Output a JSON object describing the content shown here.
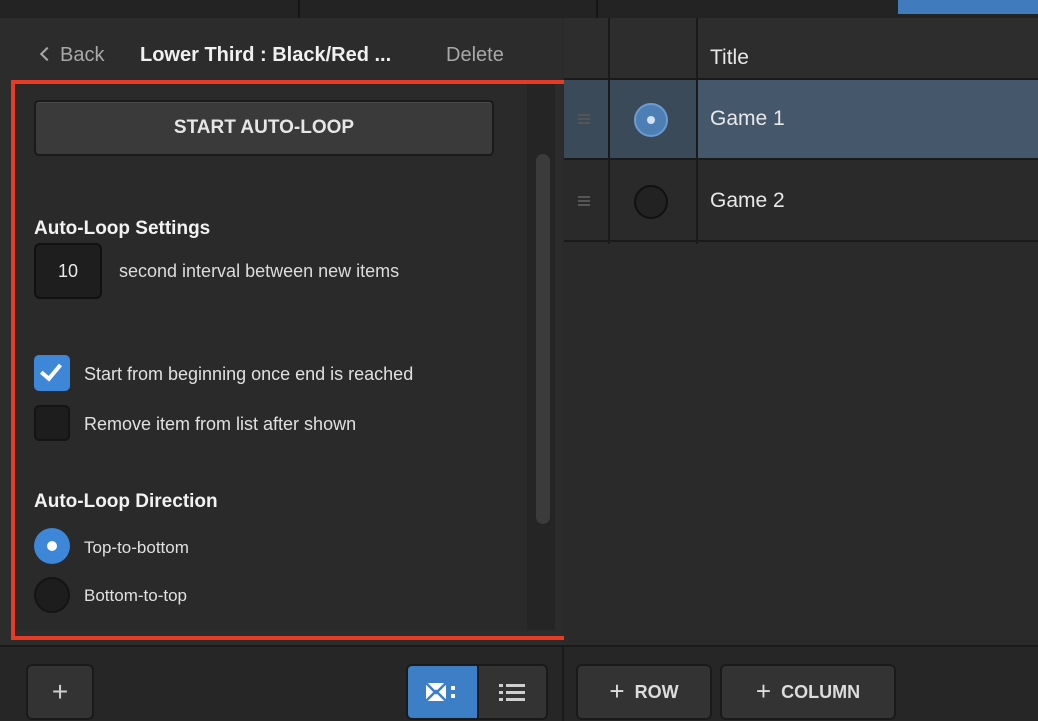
{
  "header": {
    "back_label": "Back",
    "title": "Lower Third : Black/Red ...",
    "delete_label": "Delete"
  },
  "autoloop": {
    "start_button": "START AUTO-LOOP",
    "settings_title": "Auto-Loop Settings",
    "interval_value": "10",
    "interval_label": "second interval between new items",
    "options": [
      {
        "label": "Start from beginning once end is reached",
        "checked": true
      },
      {
        "label": "Remove item from list after shown",
        "checked": false
      }
    ],
    "direction_title": "Auto-Loop Direction",
    "directions": [
      {
        "label": "Top-to-bottom",
        "selected": true
      },
      {
        "label": "Bottom-to-top",
        "selected": false
      }
    ]
  },
  "table": {
    "column_title": "Title",
    "rows": [
      {
        "title": "Game 1",
        "selected": true
      },
      {
        "title": "Game 2",
        "selected": false
      }
    ]
  },
  "footer": {
    "add_row_label": "ROW",
    "add_column_label": "COLUMN"
  },
  "colors": {
    "accent": "#3d86d8",
    "highlight_border": "#e83a24",
    "selected_row": "#3b4a58"
  }
}
